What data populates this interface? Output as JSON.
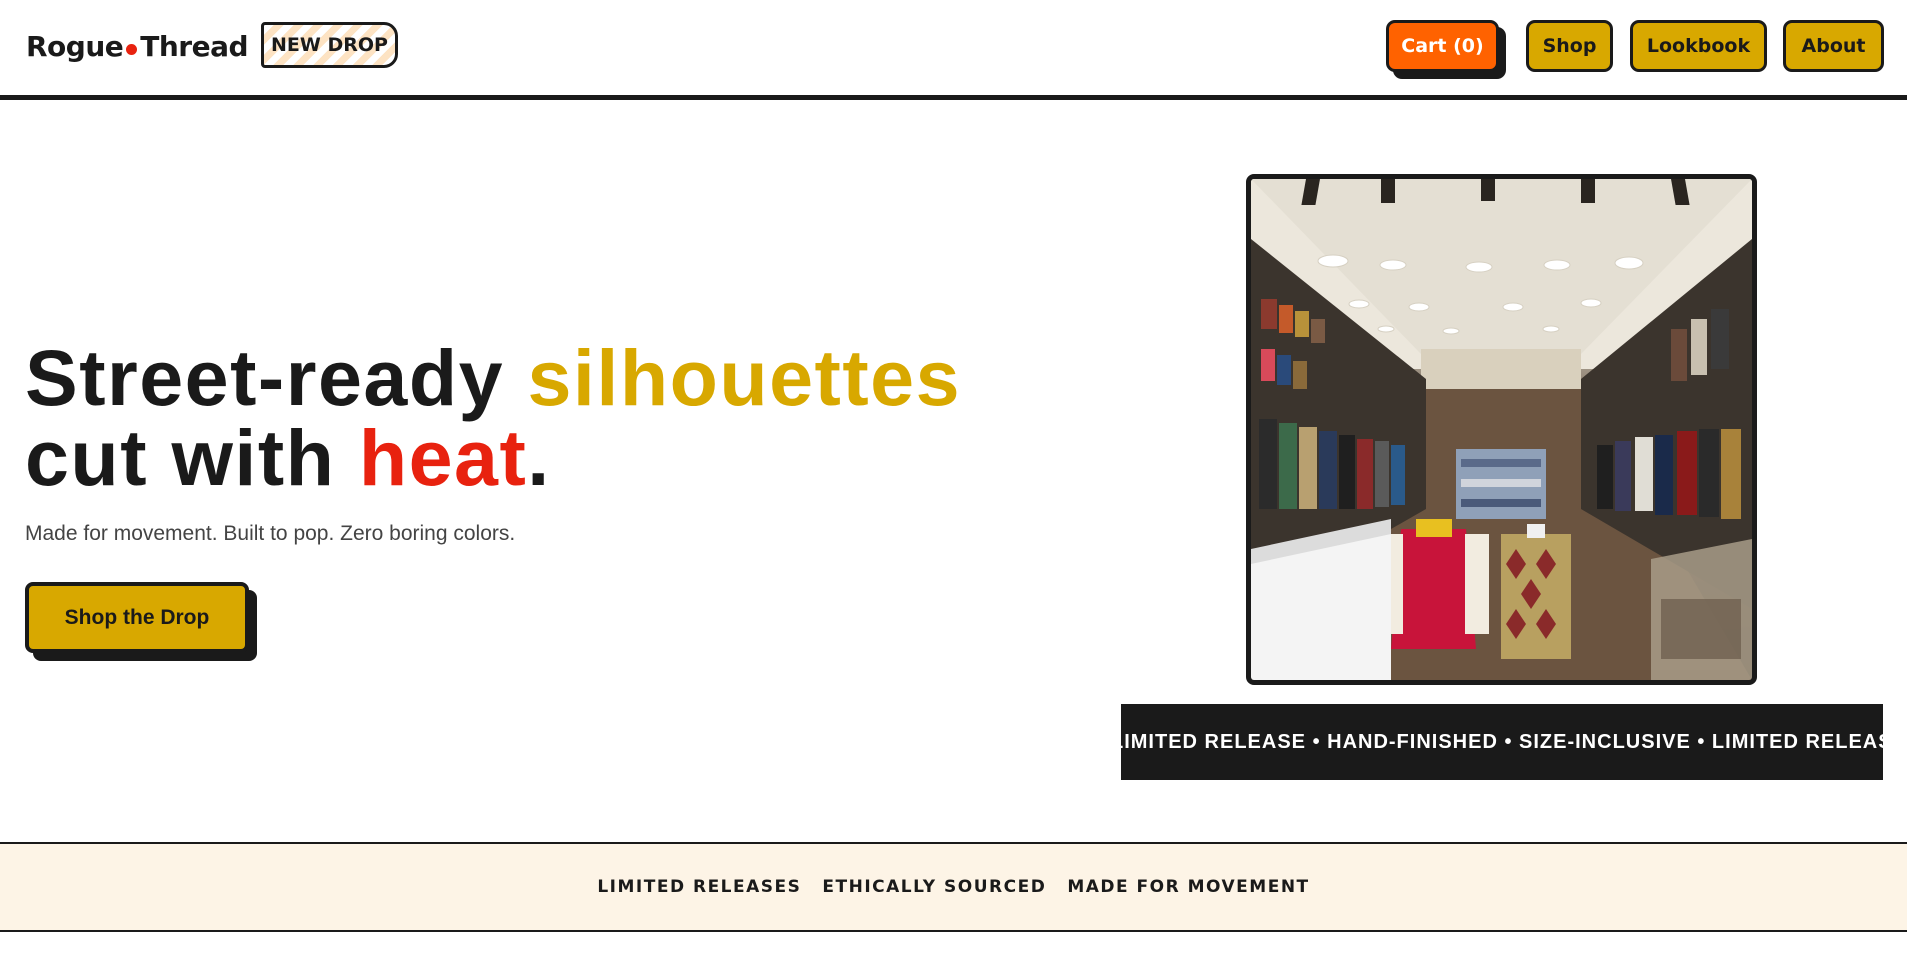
{
  "brand": {
    "name_left": "Rogue",
    "name_right": "Thread",
    "dot_color": "#e8220f",
    "badge": "NEW DROP"
  },
  "nav": {
    "cart": "Cart (0)",
    "shop": "Shop",
    "lookbook": "Lookbook",
    "about": "About"
  },
  "hero": {
    "headline_part1": "Street-ready ",
    "headline_accent1": "silhouettes",
    "headline_part2": "cut with ",
    "headline_accent2": "heat",
    "headline_end": ".",
    "subline": "Made for movement. Built to pop. Zero boring colors.",
    "cta": "Shop the Drop"
  },
  "marquee": {
    "text": "LIMITED RELEASE • HAND-FINISHED • SIZE-INCLUSIVE • LIMITED RELEASE • HAND-FINISHED • SIZE-INCLUSIVE"
  },
  "values": {
    "items": [
      "LIMITED RELEASES",
      "ETHICALLY SOURCED",
      "MADE FOR MOVEMENT"
    ]
  },
  "colors": {
    "ink": "#1a1a1a",
    "gold": "#d8a800",
    "orange": "#ff6200",
    "red": "#e8220f",
    "cream": "#fdf4e6"
  }
}
